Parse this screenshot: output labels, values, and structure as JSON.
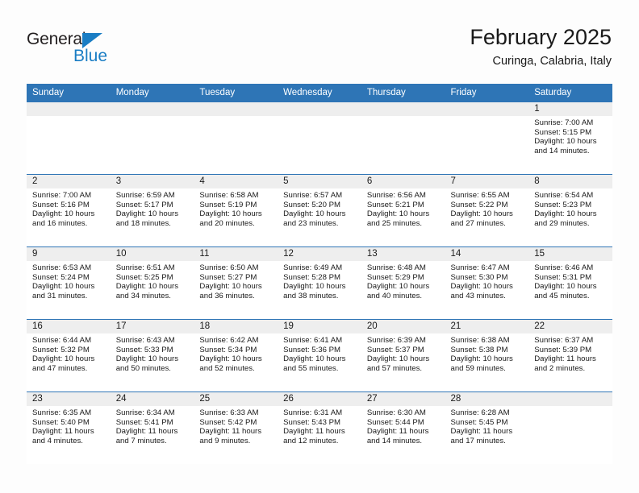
{
  "brand": {
    "name_part1": "General",
    "name_part2": "Blue",
    "triangle_color": "#1a7dc4",
    "text_color": "#231f20"
  },
  "header": {
    "title": "February 2025",
    "subtitle": "Curinga, Calabria, Italy"
  },
  "colors": {
    "header_blue": "#2e75b6",
    "day_band_gray": "#eeeeee",
    "page_background": "#fdfdfd",
    "text": "#1a1a1a"
  },
  "weekdays": [
    "Sunday",
    "Monday",
    "Tuesday",
    "Wednesday",
    "Thursday",
    "Friday",
    "Saturday"
  ],
  "labels": {
    "sunrise": "Sunrise:",
    "sunset": "Sunset:",
    "daylight": "Daylight:"
  },
  "weeks": [
    [
      {
        "date": "",
        "empty": true
      },
      {
        "date": "",
        "empty": true
      },
      {
        "date": "",
        "empty": true
      },
      {
        "date": "",
        "empty": true
      },
      {
        "date": "",
        "empty": true
      },
      {
        "date": "",
        "empty": true
      },
      {
        "date": "1",
        "sunrise": "Sunrise: 7:00 AM",
        "sunset": "Sunset: 5:15 PM",
        "daylight_line1": "Daylight: 10 hours",
        "daylight_line2": "and 14 minutes."
      }
    ],
    [
      {
        "date": "2",
        "sunrise": "Sunrise: 7:00 AM",
        "sunset": "Sunset: 5:16 PM",
        "daylight_line1": "Daylight: 10 hours",
        "daylight_line2": "and 16 minutes."
      },
      {
        "date": "3",
        "sunrise": "Sunrise: 6:59 AM",
        "sunset": "Sunset: 5:17 PM",
        "daylight_line1": "Daylight: 10 hours",
        "daylight_line2": "and 18 minutes."
      },
      {
        "date": "4",
        "sunrise": "Sunrise: 6:58 AM",
        "sunset": "Sunset: 5:19 PM",
        "daylight_line1": "Daylight: 10 hours",
        "daylight_line2": "and 20 minutes."
      },
      {
        "date": "5",
        "sunrise": "Sunrise: 6:57 AM",
        "sunset": "Sunset: 5:20 PM",
        "daylight_line1": "Daylight: 10 hours",
        "daylight_line2": "and 23 minutes."
      },
      {
        "date": "6",
        "sunrise": "Sunrise: 6:56 AM",
        "sunset": "Sunset: 5:21 PM",
        "daylight_line1": "Daylight: 10 hours",
        "daylight_line2": "and 25 minutes."
      },
      {
        "date": "7",
        "sunrise": "Sunrise: 6:55 AM",
        "sunset": "Sunset: 5:22 PM",
        "daylight_line1": "Daylight: 10 hours",
        "daylight_line2": "and 27 minutes."
      },
      {
        "date": "8",
        "sunrise": "Sunrise: 6:54 AM",
        "sunset": "Sunset: 5:23 PM",
        "daylight_line1": "Daylight: 10 hours",
        "daylight_line2": "and 29 minutes."
      }
    ],
    [
      {
        "date": "9",
        "sunrise": "Sunrise: 6:53 AM",
        "sunset": "Sunset: 5:24 PM",
        "daylight_line1": "Daylight: 10 hours",
        "daylight_line2": "and 31 minutes."
      },
      {
        "date": "10",
        "sunrise": "Sunrise: 6:51 AM",
        "sunset": "Sunset: 5:25 PM",
        "daylight_line1": "Daylight: 10 hours",
        "daylight_line2": "and 34 minutes."
      },
      {
        "date": "11",
        "sunrise": "Sunrise: 6:50 AM",
        "sunset": "Sunset: 5:27 PM",
        "daylight_line1": "Daylight: 10 hours",
        "daylight_line2": "and 36 minutes."
      },
      {
        "date": "12",
        "sunrise": "Sunrise: 6:49 AM",
        "sunset": "Sunset: 5:28 PM",
        "daylight_line1": "Daylight: 10 hours",
        "daylight_line2": "and 38 minutes."
      },
      {
        "date": "13",
        "sunrise": "Sunrise: 6:48 AM",
        "sunset": "Sunset: 5:29 PM",
        "daylight_line1": "Daylight: 10 hours",
        "daylight_line2": "and 40 minutes."
      },
      {
        "date": "14",
        "sunrise": "Sunrise: 6:47 AM",
        "sunset": "Sunset: 5:30 PM",
        "daylight_line1": "Daylight: 10 hours",
        "daylight_line2": "and 43 minutes."
      },
      {
        "date": "15",
        "sunrise": "Sunrise: 6:46 AM",
        "sunset": "Sunset: 5:31 PM",
        "daylight_line1": "Daylight: 10 hours",
        "daylight_line2": "and 45 minutes."
      }
    ],
    [
      {
        "date": "16",
        "sunrise": "Sunrise: 6:44 AM",
        "sunset": "Sunset: 5:32 PM",
        "daylight_line1": "Daylight: 10 hours",
        "daylight_line2": "and 47 minutes."
      },
      {
        "date": "17",
        "sunrise": "Sunrise: 6:43 AM",
        "sunset": "Sunset: 5:33 PM",
        "daylight_line1": "Daylight: 10 hours",
        "daylight_line2": "and 50 minutes."
      },
      {
        "date": "18",
        "sunrise": "Sunrise: 6:42 AM",
        "sunset": "Sunset: 5:34 PM",
        "daylight_line1": "Daylight: 10 hours",
        "daylight_line2": "and 52 minutes."
      },
      {
        "date": "19",
        "sunrise": "Sunrise: 6:41 AM",
        "sunset": "Sunset: 5:36 PM",
        "daylight_line1": "Daylight: 10 hours",
        "daylight_line2": "and 55 minutes."
      },
      {
        "date": "20",
        "sunrise": "Sunrise: 6:39 AM",
        "sunset": "Sunset: 5:37 PM",
        "daylight_line1": "Daylight: 10 hours",
        "daylight_line2": "and 57 minutes."
      },
      {
        "date": "21",
        "sunrise": "Sunrise: 6:38 AM",
        "sunset": "Sunset: 5:38 PM",
        "daylight_line1": "Daylight: 10 hours",
        "daylight_line2": "and 59 minutes."
      },
      {
        "date": "22",
        "sunrise": "Sunrise: 6:37 AM",
        "sunset": "Sunset: 5:39 PM",
        "daylight_line1": "Daylight: 11 hours",
        "daylight_line2": "and 2 minutes."
      }
    ],
    [
      {
        "date": "23",
        "sunrise": "Sunrise: 6:35 AM",
        "sunset": "Sunset: 5:40 PM",
        "daylight_line1": "Daylight: 11 hours",
        "daylight_line2": "and 4 minutes."
      },
      {
        "date": "24",
        "sunrise": "Sunrise: 6:34 AM",
        "sunset": "Sunset: 5:41 PM",
        "daylight_line1": "Daylight: 11 hours",
        "daylight_line2": "and 7 minutes."
      },
      {
        "date": "25",
        "sunrise": "Sunrise: 6:33 AM",
        "sunset": "Sunset: 5:42 PM",
        "daylight_line1": "Daylight: 11 hours",
        "daylight_line2": "and 9 minutes."
      },
      {
        "date": "26",
        "sunrise": "Sunrise: 6:31 AM",
        "sunset": "Sunset: 5:43 PM",
        "daylight_line1": "Daylight: 11 hours",
        "daylight_line2": "and 12 minutes."
      },
      {
        "date": "27",
        "sunrise": "Sunrise: 6:30 AM",
        "sunset": "Sunset: 5:44 PM",
        "daylight_line1": "Daylight: 11 hours",
        "daylight_line2": "and 14 minutes."
      },
      {
        "date": "28",
        "sunrise": "Sunrise: 6:28 AM",
        "sunset": "Sunset: 5:45 PM",
        "daylight_line1": "Daylight: 11 hours",
        "daylight_line2": "and 17 minutes."
      },
      {
        "date": "",
        "empty": true
      }
    ]
  ]
}
